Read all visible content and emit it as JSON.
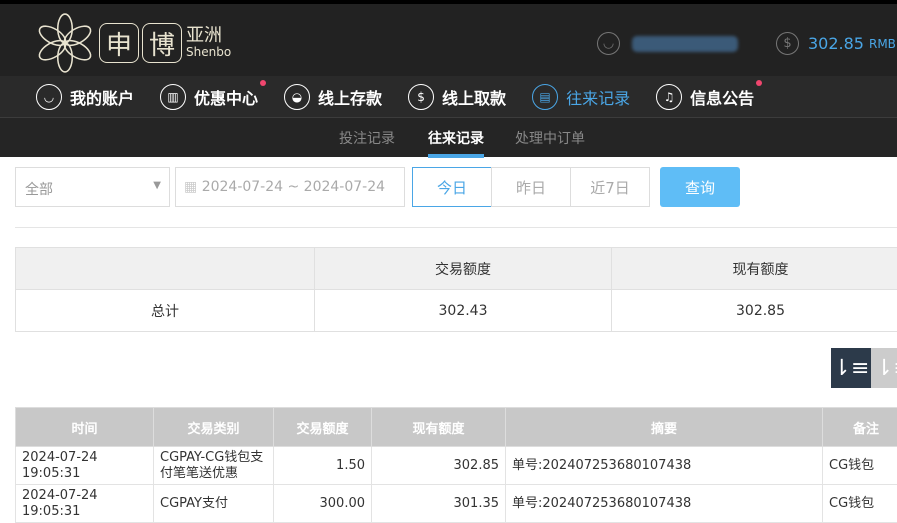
{
  "header": {
    "logo_char1": "申",
    "logo_char2": "博",
    "logo_cn": "亚洲",
    "logo_en": "Shenbo",
    "balance": "302.85",
    "currency": "RMB"
  },
  "nav": [
    {
      "label": "我的账户",
      "icon": "user-icon"
    },
    {
      "label": "优惠中心",
      "icon": "gift-icon",
      "dot": true
    },
    {
      "label": "线上存款",
      "icon": "deposit-icon"
    },
    {
      "label": "线上取款",
      "icon": "withdraw-icon"
    },
    {
      "label": "往来记录",
      "icon": "record-icon",
      "active": true
    },
    {
      "label": "信息公告",
      "icon": "bell-icon",
      "dot": true
    }
  ],
  "subtabs": [
    "投注记录",
    "往来记录",
    "处理中订单"
  ],
  "filters": {
    "type": "全部",
    "date_range": "2024-07-24 ~ 2024-07-24",
    "today": "今日",
    "yesterday": "昨日",
    "last7": "近7日",
    "query": "查询"
  },
  "summary": {
    "headers": [
      "",
      "交易额度",
      "现有额度"
    ],
    "row": [
      "总计",
      "302.43",
      "302.85"
    ]
  },
  "table": {
    "headers": [
      "时间",
      "交易类别",
      "交易额度",
      "现有额度",
      "摘要",
      "备注"
    ],
    "rows": [
      [
        "2024-07-24 19:05:31",
        "CGPAY-CG钱包支付笔笔送优惠",
        "1.50",
        "302.85",
        "单号:202407253680107438",
        "CG钱包"
      ],
      [
        "2024-07-24 19:05:31",
        "CGPAY支付",
        "300.00",
        "301.35",
        "单号:202407253680107438",
        "CG钱包"
      ]
    ]
  },
  "colors": {
    "accent": "#4aa6e6",
    "header_bg": "#222222",
    "query_btn": "#5fbdf6"
  }
}
